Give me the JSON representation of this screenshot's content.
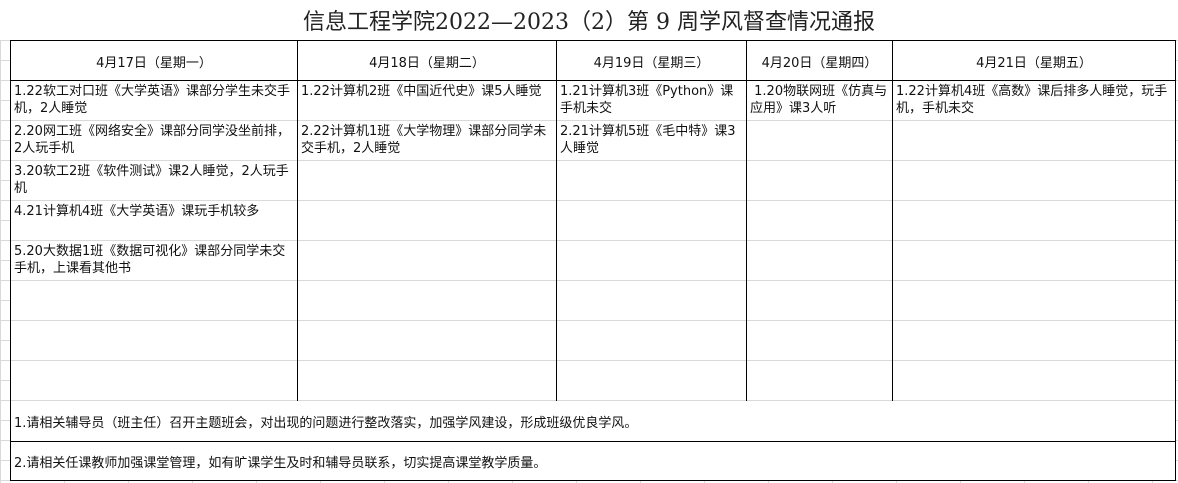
{
  "title": "信息工程学院2022—2023（2）第 9 周学风督查情况通报",
  "columns": [
    {
      "header": "4月17日（星期一）",
      "entries": [
        "1.22软工对口班《大学英语》课部分学生未交手机，2人睡觉",
        "2.20网工班《网络安全》课部分同学没坐前排，2人玩手机",
        "3.20软工2班《软件测试》课2人睡觉，2人玩手机",
        "4.21计算机4班《大学英语》课玩手机较多",
        "5.20大数据1班《数据可视化》课部分同学未交手机，上课看其他书"
      ]
    },
    {
      "header": "4月18日（星期二）",
      "entries": [
        "1.22计算机2班《中国近代史》课5人睡觉",
        "2.22计算机1班《大学物理》课部分同学未交手机，2人睡觉"
      ]
    },
    {
      "header": "4月19日（星期三）",
      "entries": [
        "1.21计算机3班《Python》课手机未交",
        "2.21计算机5班《毛中特》课3人睡觉"
      ]
    },
    {
      "header": "4月20日（星期四）",
      "entries": [
        " 1.20物联网班《仿真与应用》课3人听"
      ]
    },
    {
      "header": "4月21日（星期五）",
      "entries": [
        "1.22计算机4班《高数》课后排多人睡觉，玩手机，手机未交"
      ]
    }
  ],
  "notes": [
    "1.请相关辅导员（班主任）召开主题班会，对出现的问题进行整改落实，加强学风建设，形成班级优良学风。",
    "2.请相关任课教师加强课堂管理，如有旷课学生及时和辅导员联系，切实提高课堂教学质量。"
  ]
}
